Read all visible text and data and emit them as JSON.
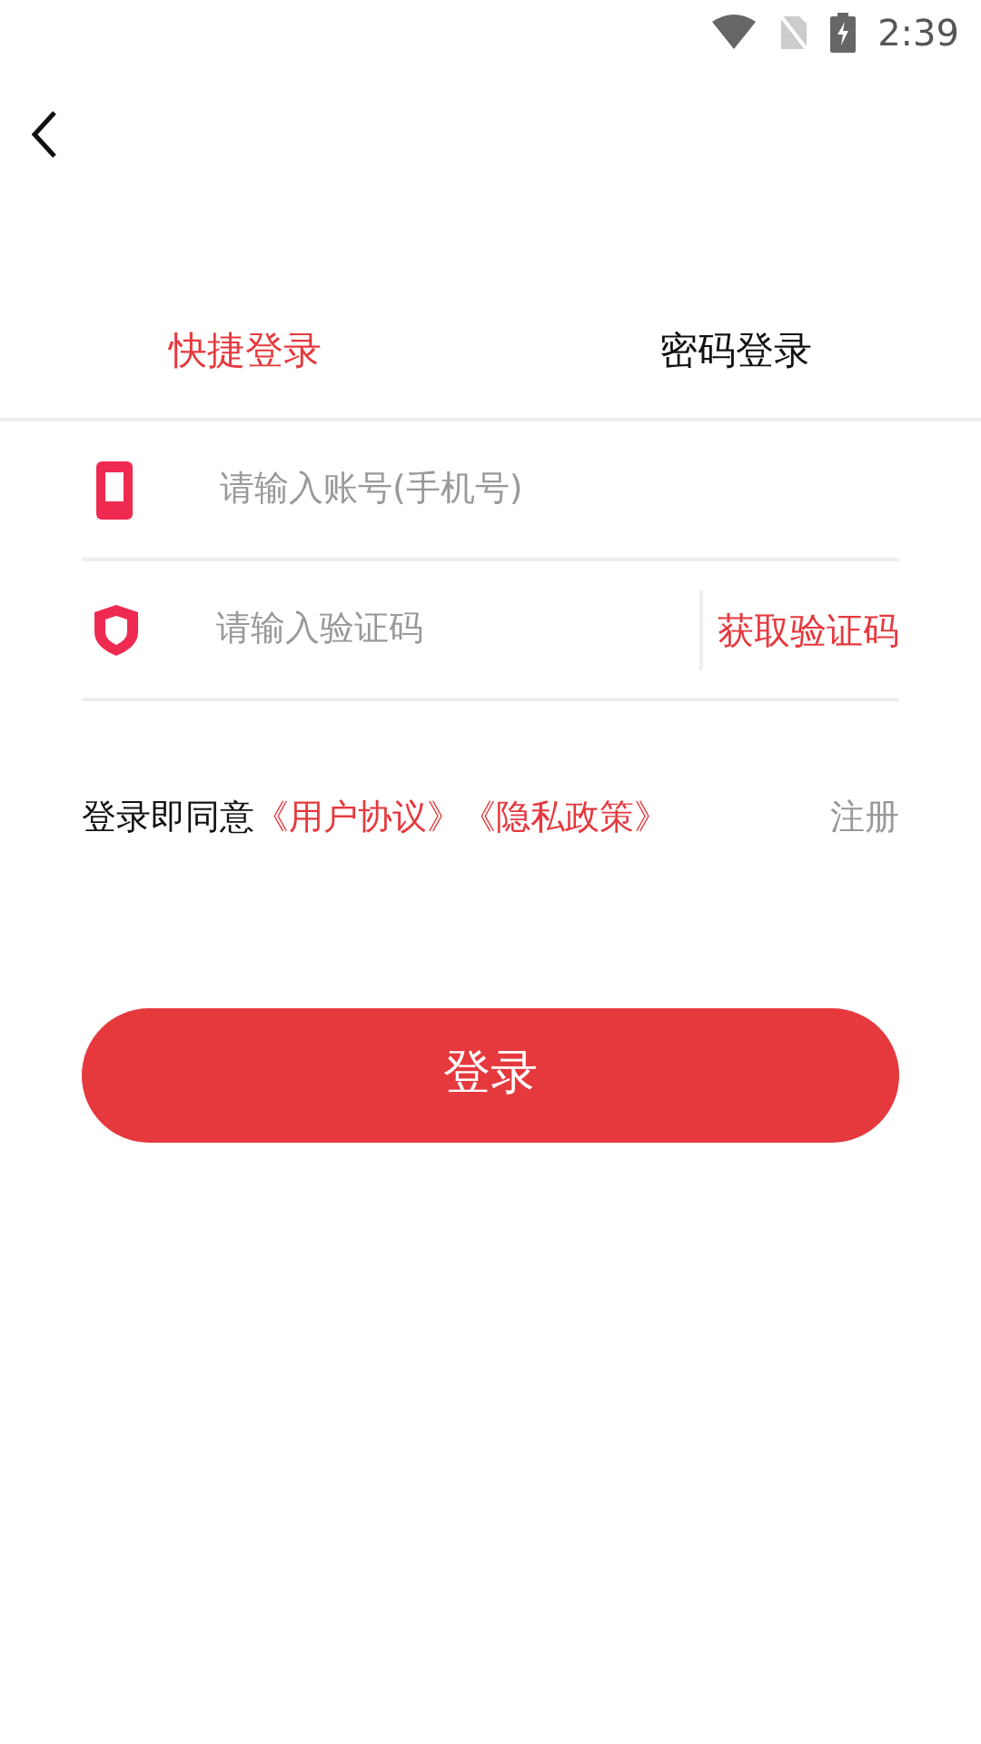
{
  "status_bar": {
    "time": "2:39"
  },
  "tabs": [
    {
      "label": "快捷登录",
      "selected": true
    },
    {
      "label": "密码登录",
      "selected": false
    }
  ],
  "fields": [
    {
      "kind": "phone",
      "placeholder": "请输入账号(手机号)"
    },
    {
      "kind": "code",
      "placeholder": "请输入验证码",
      "action": "获取验证码"
    }
  ],
  "agreement": {
    "prefix": "登录即同意",
    "links": [
      "《用户协议》",
      "《隐私政策》"
    ]
  },
  "register": "注册",
  "submit": "登录"
}
